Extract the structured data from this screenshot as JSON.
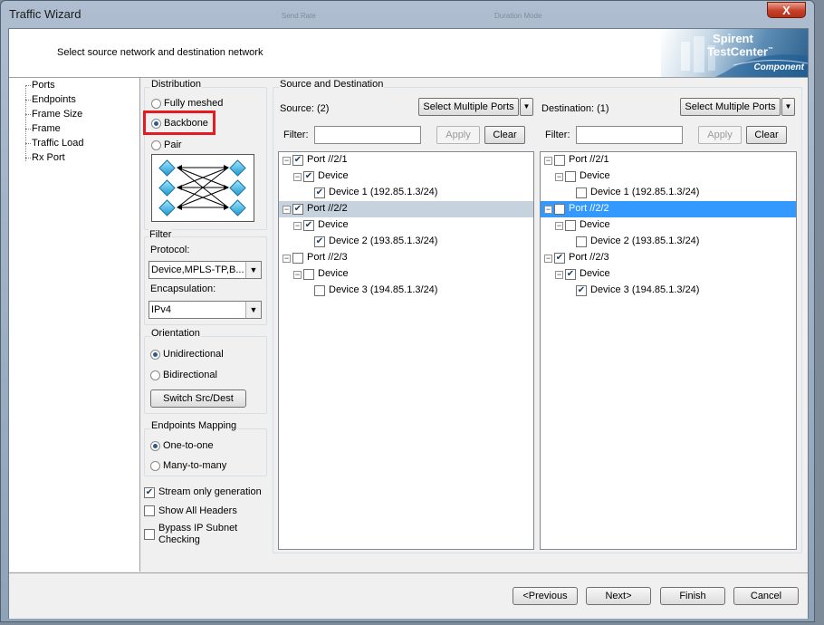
{
  "window": {
    "title": "Traffic Wizard",
    "close_glyph": "X",
    "ghost_text": [
      "Send Rate",
      "Duration Mode"
    ]
  },
  "header": {
    "instruction": "Select source network and destination network",
    "logo": {
      "line1": "Spirent",
      "line2": "TestCenter",
      "trademark": "™",
      "subtitle": "Component"
    }
  },
  "nav": {
    "items": [
      "Ports",
      "Endpoints",
      "Frame Size",
      "Frame",
      "Traffic Load",
      "Rx Port"
    ]
  },
  "distribution": {
    "label": "Distribution",
    "options": [
      "Fully meshed",
      "Backbone",
      "Pair"
    ],
    "selected": "Backbone"
  },
  "filter": {
    "label": "Filter",
    "protocol_label": "Protocol:",
    "protocol_value": "Device,MPLS-TP,B...",
    "encapsulation_label": "Encapsulation:",
    "encapsulation_value": "IPv4"
  },
  "orientation": {
    "label": "Orientation",
    "options": [
      "Unidirectional",
      "Bidirectional"
    ],
    "selected": "Unidirectional",
    "switch_button": "Switch Src/Dest"
  },
  "endpoints_mapping": {
    "label": "Endpoints Mapping",
    "options": [
      "One-to-one",
      "Many-to-many"
    ],
    "selected": "One-to-one"
  },
  "checkboxes": [
    {
      "label": "Stream only generation",
      "checked": true
    },
    {
      "label": "Show All Headers",
      "checked": false
    },
    {
      "label": "Bypass IP Subnet Checking",
      "line1": "Bypass IP Subnet",
      "line2": "Checking",
      "checked": false
    }
  ],
  "source_destination": {
    "label": "Source and Destination",
    "source": {
      "label": "Source: (2)",
      "select_button": "Select Multiple Ports",
      "filter_label": "Filter:",
      "apply_button": "Apply",
      "clear_button": "Clear",
      "tree": [
        {
          "text": "Port //2/1",
          "checked": true,
          "level": 0
        },
        {
          "text": "Device",
          "checked": true,
          "level": 1
        },
        {
          "text": "Device 1 (192.85.1.3/24)",
          "checked": true,
          "level": 2
        },
        {
          "text": "Port //2/2",
          "checked": true,
          "level": 0,
          "selected": true
        },
        {
          "text": "Device",
          "checked": true,
          "level": 1
        },
        {
          "text": "Device 2 (193.85.1.3/24)",
          "checked": true,
          "level": 2
        },
        {
          "text": "Port //2/3",
          "checked": false,
          "level": 0
        },
        {
          "text": "Device",
          "checked": false,
          "level": 1
        },
        {
          "text": "Device 3 (194.85.1.3/24)",
          "checked": false,
          "level": 2
        }
      ]
    },
    "destination": {
      "label": "Destination: (1)",
      "select_button": "Select Multiple Ports",
      "filter_label": "Filter:",
      "apply_button": "Apply",
      "clear_button": "Clear",
      "tree": [
        {
          "text": "Port //2/1",
          "checked": false,
          "level": 0
        },
        {
          "text": "Device",
          "checked": false,
          "level": 1
        },
        {
          "text": "Device 1 (192.85.1.3/24)",
          "checked": false,
          "level": 2
        },
        {
          "text": "Port //2/2",
          "checked": false,
          "level": 0,
          "selected": true
        },
        {
          "text": "Device",
          "checked": false,
          "level": 1
        },
        {
          "text": "Device 2 (193.85.1.3/24)",
          "checked": false,
          "level": 2
        },
        {
          "text": "Port //2/3",
          "checked": true,
          "level": 0
        },
        {
          "text": "Device",
          "checked": true,
          "level": 1
        },
        {
          "text": "Device 3 (194.85.1.3/24)",
          "checked": true,
          "level": 2
        }
      ]
    }
  },
  "footer": {
    "buttons": [
      "<Previous",
      "Next>",
      "Finish",
      "Cancel"
    ]
  },
  "colors": {
    "highlight": "#e31b23",
    "selection_blue": "#3399ff",
    "selection_grey": "#c6d2dd"
  }
}
